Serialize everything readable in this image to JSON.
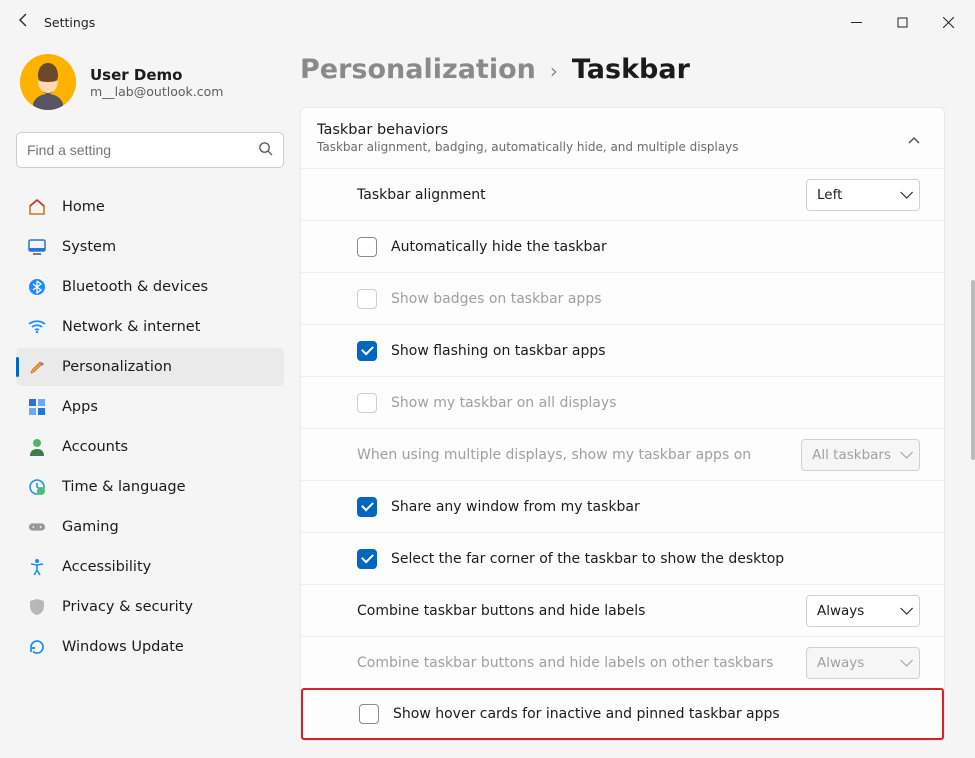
{
  "window": {
    "app_title": "Settings"
  },
  "profile": {
    "name": "User Demo",
    "email": "m__lab@outlook.com"
  },
  "search": {
    "placeholder": "Find a setting"
  },
  "sidebar": {
    "items": [
      {
        "label": "Home"
      },
      {
        "label": "System"
      },
      {
        "label": "Bluetooth & devices"
      },
      {
        "label": "Network & internet"
      },
      {
        "label": "Personalization"
      },
      {
        "label": "Apps"
      },
      {
        "label": "Accounts"
      },
      {
        "label": "Time & language"
      },
      {
        "label": "Gaming"
      },
      {
        "label": "Accessibility"
      },
      {
        "label": "Privacy & security"
      },
      {
        "label": "Windows Update"
      }
    ]
  },
  "breadcrumb": {
    "parent": "Personalization",
    "current": "Taskbar"
  },
  "card": {
    "title": "Taskbar behaviors",
    "subtitle": "Taskbar alignment, badging, automatically hide, and multiple displays"
  },
  "rows": {
    "alignment": {
      "label": "Taskbar alignment",
      "value": "Left"
    },
    "autohide": {
      "label": "Automatically hide the taskbar"
    },
    "badges": {
      "label": "Show badges on taskbar apps"
    },
    "flashing": {
      "label": "Show flashing on taskbar apps"
    },
    "all_displays": {
      "label": "Show my taskbar on all displays"
    },
    "multi_where": {
      "label": "When using multiple displays, show my taskbar apps on",
      "value": "All taskbars"
    },
    "share_window": {
      "label": "Share any window from my taskbar"
    },
    "far_corner": {
      "label": "Select the far corner of the taskbar to show the desktop"
    },
    "combine": {
      "label": "Combine taskbar buttons and hide labels",
      "value": "Always"
    },
    "combine_other": {
      "label": "Combine taskbar buttons and hide labels on other taskbars",
      "value": "Always"
    },
    "hover_cards": {
      "label": "Show hover cards for inactive and pinned taskbar apps"
    }
  }
}
